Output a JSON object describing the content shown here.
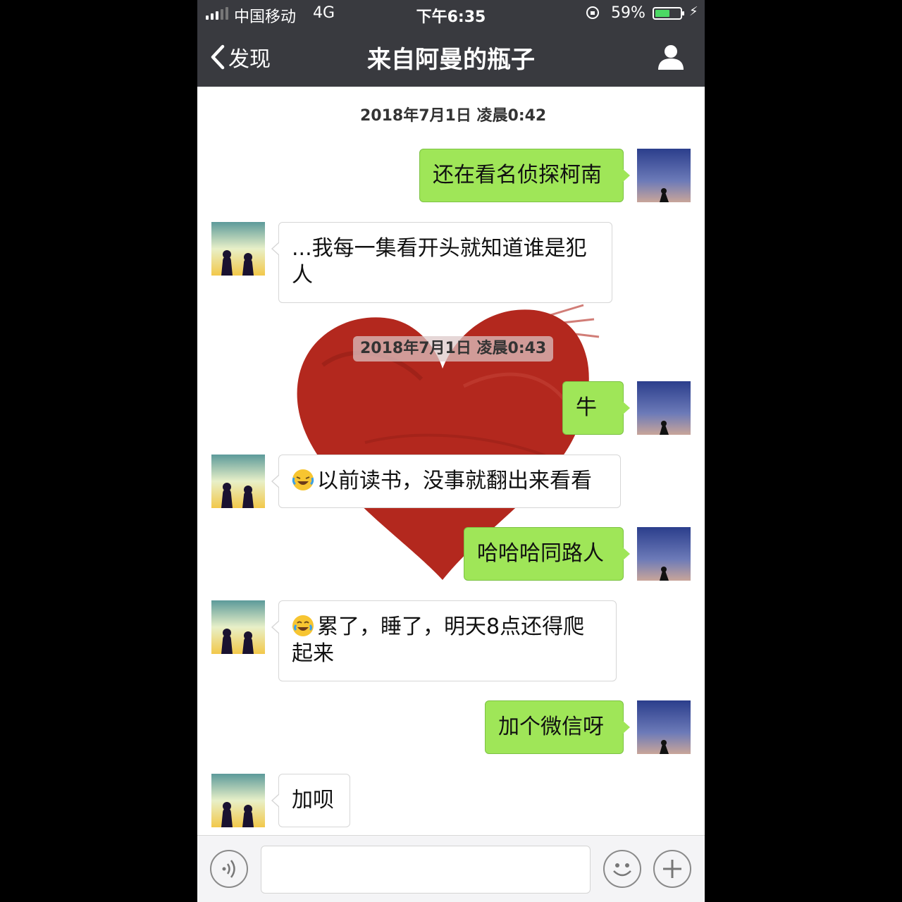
{
  "status_bar": {
    "carrier": "中国移动",
    "network": "4G",
    "time": "下午6:35",
    "battery_percent": "59%",
    "battery_level": 0.59
  },
  "nav": {
    "back_label": "发现",
    "title": "来自阿曼的瓶子"
  },
  "colors": {
    "nav_bg": "#393a3f",
    "my_bubble": "#9fe658",
    "other_bubble": "#ffffff",
    "background_heart": "#b3281e"
  },
  "chat": {
    "timestamps": [
      "2018年7月1日 凌晨0:42",
      "2018年7月1日 凌晨0:43"
    ],
    "messages": [
      {
        "sender": "me",
        "text": "还在看名侦探柯南"
      },
      {
        "sender": "other",
        "text": "...我每一集看开头就知道谁是犯人"
      },
      {
        "sender": "me",
        "text": "牛"
      },
      {
        "sender": "other",
        "emoji": "crying-laughing-emoji",
        "text": "以前读书，没事就翻出来看看"
      },
      {
        "sender": "me",
        "text": "哈哈哈同路人"
      },
      {
        "sender": "other",
        "emoji": "tears-of-joy-emoji",
        "text": "累了，睡了，明天8点还得爬起来"
      },
      {
        "sender": "me",
        "text": "加个微信呀"
      },
      {
        "sender": "other",
        "text": "加呗"
      }
    ]
  },
  "input_bar": {
    "icons": [
      "voice-icon",
      "emoji-icon",
      "plus-icon"
    ],
    "text_value": ""
  }
}
